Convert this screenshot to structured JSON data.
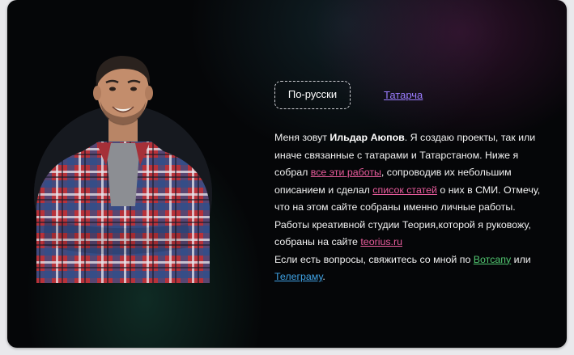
{
  "languages": {
    "active": "По-русски",
    "alternate": "Татарча"
  },
  "bio": {
    "intro": "Меня зовут ",
    "name": "Ильдар Аюпов",
    "p1": ". Я создаю проекты, так или иначе связанные с татарами и Татарстаном. Ниже я собрал ",
    "link_works": "все эти работы",
    "p2": ", сопроводив их небольшим описанием и сделал ",
    "link_articles": "список статей",
    "p3": " о них в СМИ. Отмечу, что на этом сайте собраны именно личные работы. Работы креативной студии Теория,которой я руковожу, собраны на сайте ",
    "link_studio": "teorius.ru",
    "p4": "Если есть вопросы, свяжитесь со мной по ",
    "link_whatsapp": "Вотсапу",
    "p5": " или ",
    "link_telegram": "Телеграму",
    "p6": "."
  },
  "colors": {
    "background": "#050608",
    "link_pink": "#e85c9c",
    "link_green": "#52c871",
    "link_blue": "#3fa3e6",
    "link_purple": "#9b7dff"
  },
  "icons": {
    "portrait": "portrait-photo"
  }
}
